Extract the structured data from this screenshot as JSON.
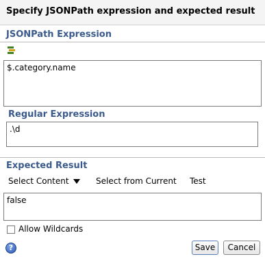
{
  "dialog": {
    "title": "Specify JSONPath expression and expected result"
  },
  "jsonpath": {
    "label": "JSONPath Expression",
    "value": "$.category.name",
    "icon": "expression-wizard-icon"
  },
  "regex": {
    "label": "Regular Expression",
    "value": ".\\d"
  },
  "expected": {
    "label": "Expected Result",
    "select_content": "Select Content",
    "select_from_current": "Select from Current",
    "test": "Test",
    "value": "false"
  },
  "options": {
    "allow_wildcards": "Allow Wildcards",
    "allow_wildcards_checked": false
  },
  "buttons": {
    "save": "Save",
    "cancel": "Cancel",
    "help_glyph": "?"
  }
}
